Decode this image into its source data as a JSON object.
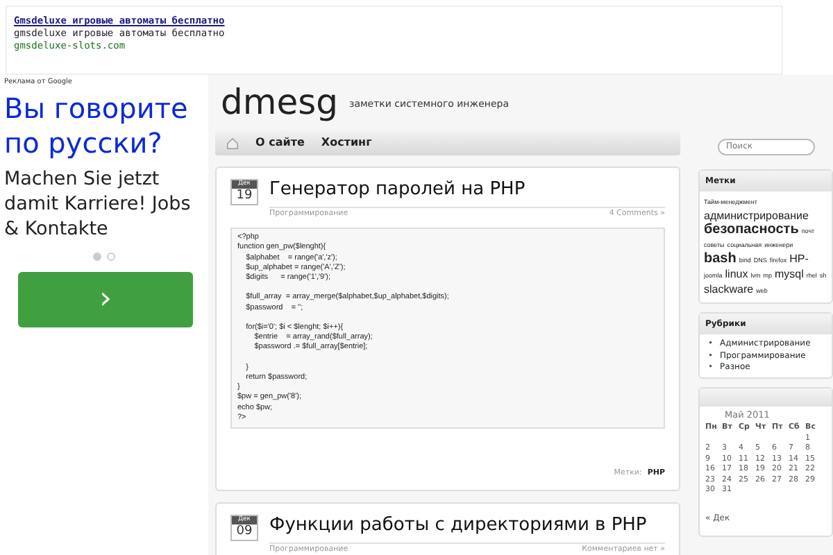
{
  "top_ad": {
    "title": "Gmsdeluxe игровые автоматы бесплатно",
    "text": "gmsdeluxe игровые автоматы бесплатно",
    "url": "gmsdeluxe-slots.com"
  },
  "side_ad": {
    "label": "Реклама от Google",
    "headline": "Вы говорите по русски?",
    "body": "Machen Sie jetzt damit Karriere! Jobs & Kontakte",
    "dots": [
      {
        "selected": true
      },
      {
        "selected": false
      }
    ],
    "button": "›"
  },
  "site": {
    "title": "dmesg",
    "tagline": "заметки системного инженера"
  },
  "nav": {
    "items": [
      "О сайте",
      "Хостинг"
    ],
    "search": {
      "placeholder": "Поиск"
    }
  },
  "posts": [
    {
      "month": "Дек",
      "day": "19",
      "title": "Генератор паролей на PHP",
      "category": "Программирование",
      "comments": "4 Comments »",
      "code_blocks": [
        [
          "<?php",
          "function gen_pw($lenght){",
          "    $alphabet    = range('a','z');",
          "    $up_alphabet = range('A','Z');",
          "    $digits      = range('1','9');"
        ],
        [
          "    $full_array  = array_merge($alphabet,$up_alphabet,$digits);",
          "    $password    = '';"
        ],
        [
          "    for($i='0'; $i < $lenght; $i++){",
          "        $entrie    = array_rand($full_array);",
          "        $password .= $full_array[$entrie];"
        ],
        [
          "    }",
          "    return $password;",
          "}",
          "$pw = gen_pw('8');",
          "echo $pw;",
          "?>"
        ]
      ],
      "tags_label": "Метки:",
      "tags": "PHP"
    },
    {
      "month": "Дек",
      "day": "09",
      "title": "Функции работы с директориями в PHP",
      "category": "Программирование",
      "comments": "Комментариев нет »"
    }
  ],
  "tags_widget": {
    "title": "Метки",
    "tags": [
      {
        "text": "Тайм-менеджмент",
        "kind": "small"
      },
      {
        "text": "администрирование",
        "kind": "medium"
      },
      {
        "text": "безопасность",
        "kind": "large"
      },
      {
        "text": "почт",
        "kind": "small"
      },
      {
        "text": "советы",
        "kind": "small"
      },
      {
        "text": "социальная",
        "kind": "small"
      },
      {
        "text": "инженери",
        "kind": "small"
      },
      {
        "text": "bash",
        "kind": "large"
      },
      {
        "text": "bind",
        "kind": "small"
      },
      {
        "text": "DNS",
        "kind": "small"
      },
      {
        "text": "firefox",
        "kind": "small"
      },
      {
        "text": "HP-",
        "kind": "medium"
      },
      {
        "text": "joomla",
        "kind": "small"
      },
      {
        "text": "linux",
        "kind": "medium"
      },
      {
        "text": "lvm",
        "kind": "small"
      },
      {
        "text": "mp",
        "kind": "small"
      },
      {
        "text": "mysql",
        "kind": "medium"
      },
      {
        "text": "rhel",
        "kind": "small"
      },
      {
        "text": "sh",
        "kind": "small"
      },
      {
        "text": "slackware",
        "kind": "medium"
      },
      {
        "text": "web",
        "kind": "small"
      }
    ]
  },
  "categories_widget": {
    "title": "Рубрики",
    "bullet": "•",
    "items": [
      "Администрирование",
      "Программирование",
      "Разное"
    ]
  },
  "calendar": {
    "caption": "Май 2011",
    "weekdays": [
      "Пн",
      "Вт",
      "Ср",
      "Чт",
      "Пт",
      "Сб",
      "Вс"
    ],
    "weeks": [
      {
        "kind": "first",
        "days": [
          "1"
        ]
      },
      {
        "kind": "full",
        "days": [
          "2",
          "3",
          "4",
          "5",
          "6",
          "7",
          "8"
        ]
      },
      {
        "kind": "full",
        "days": [
          "9",
          "10",
          "11",
          "12",
          "13",
          "14",
          "15"
        ]
      },
      {
        "kind": "full",
        "days": [
          "16",
          "17",
          "18",
          "19",
          "20",
          "21",
          "22"
        ]
      },
      {
        "kind": "full",
        "days": [
          "23",
          "24",
          "25",
          "26",
          "27",
          "28",
          "29"
        ]
      },
      {
        "kind": "last",
        "days": [
          "30",
          "31"
        ]
      }
    ],
    "prev": "« Дек"
  }
}
